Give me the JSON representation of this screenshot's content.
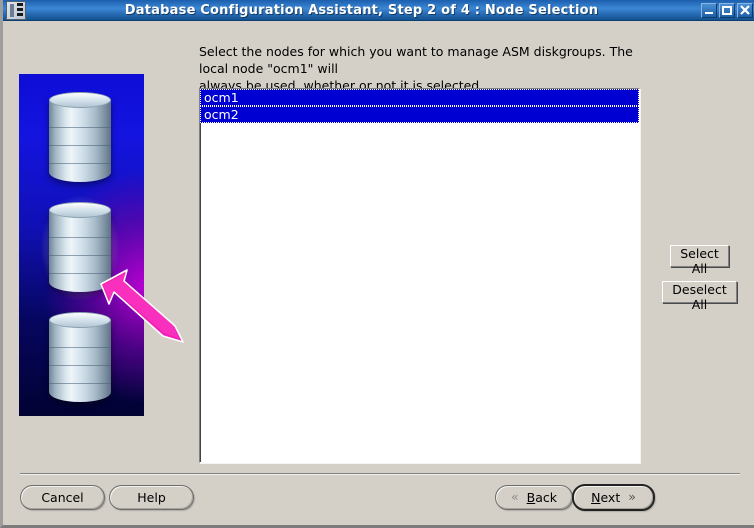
{
  "window": {
    "title": "Database Configuration Assistant, Step 2 of 4 : Node Selection",
    "icon": "database-document-icon",
    "controls": {
      "minimize": "minimize-icon",
      "maximize": "maximize-icon",
      "close": "close-icon"
    }
  },
  "main": {
    "instructions_line1": "Select the nodes for which you want to manage ASM  diskgroups.  The local node \"ocm1\" will",
    "instructions_line2": "always be used, whether or not it is selected.",
    "node_list": [
      {
        "label": "ocm1",
        "selected": true
      },
      {
        "label": "ocm2",
        "selected": true
      }
    ],
    "side_buttons": {
      "select_all": "Select All",
      "deselect_all": "Deselect All"
    },
    "graphic": {
      "name": "database-cluster-illustration",
      "cylinder_count": 3,
      "highlighted_cylinder": 2,
      "arrow": "magenta-pointer-arrow"
    }
  },
  "footer": {
    "cancel": "Cancel",
    "help": "Help",
    "back": "Back",
    "back_mnemonic": "B",
    "next": "Next",
    "next_mnemonic": "N",
    "back_icon": "double-chevron-left-icon",
    "next_icon": "double-chevron-right-icon"
  },
  "colors": {
    "titlebar_blue": "#2f76c2",
    "selection_blue": "#0000d2",
    "dialog_gray": "#d4d0c8",
    "graphic_blue": "#1010b4",
    "graphic_magenta": "#c400d6",
    "arrow_magenta": "#ef2ab4"
  }
}
